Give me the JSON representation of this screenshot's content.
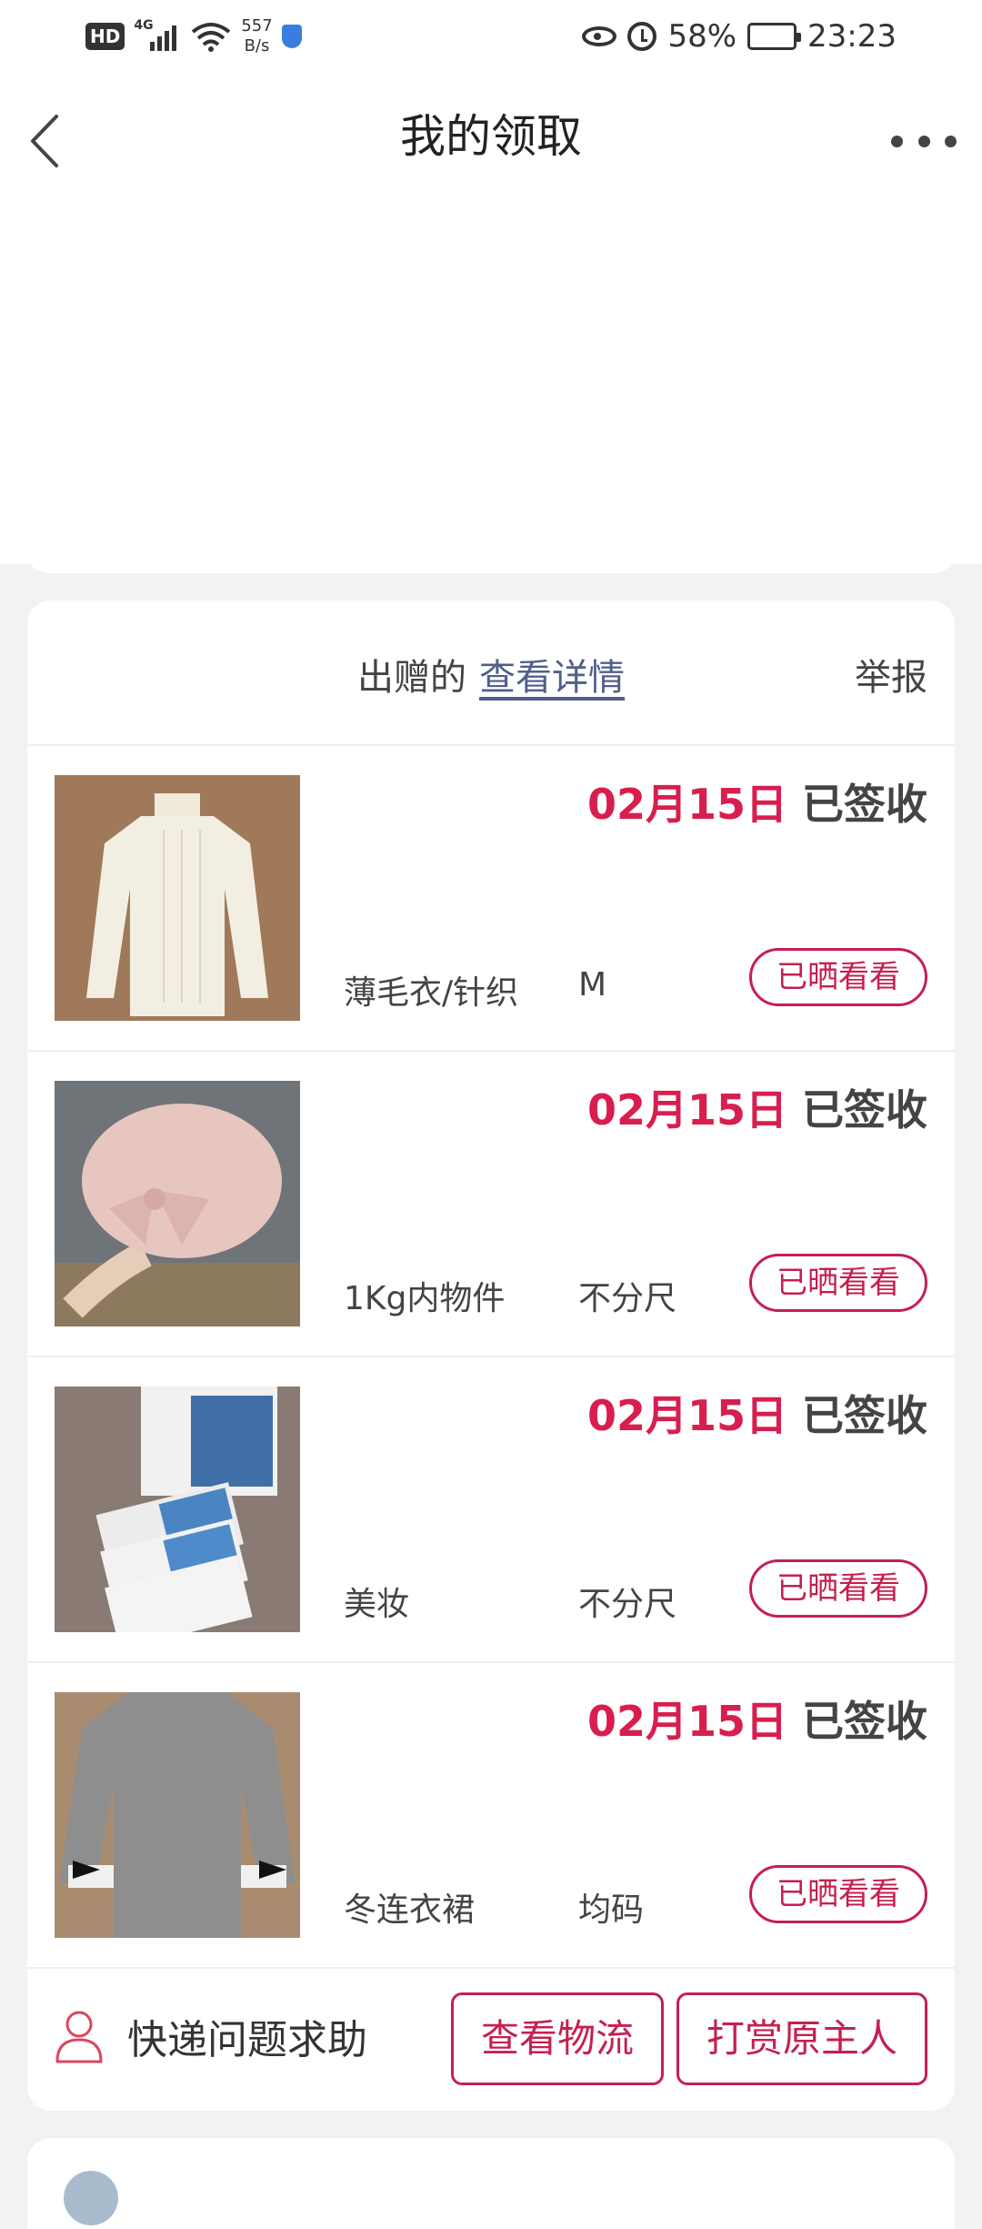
{
  "status_bar": {
    "hd_label": "HD",
    "network_label": "4G",
    "speed_value": "557",
    "speed_unit": "B/s",
    "battery_text": "58%",
    "time": "23:23"
  },
  "nav": {
    "title": "我的领取"
  },
  "card": {
    "header_prefix": "出赠的",
    "detail_link": "查看详情",
    "report_label": "举报",
    "items": [
      {
        "date": "02月15日",
        "status": "已签收",
        "category": "薄毛衣/针织",
        "size": "M",
        "button": "已晒看看"
      },
      {
        "date": "02月15日",
        "status": "已签收",
        "category": "1Kg内物件",
        "size": "不分尺",
        "button": "已晒看看"
      },
      {
        "date": "02月15日",
        "status": "已签收",
        "category": "美妆",
        "size": "不分尺",
        "button": "已晒看看"
      },
      {
        "date": "02月15日",
        "status": "已签收",
        "category": "冬连衣裙",
        "size": "均码",
        "button": "已晒看看"
      }
    ],
    "footer": {
      "help_label": "快递问题求助",
      "logistics_button": "查看物流",
      "tip_button": "打赏原主人"
    }
  },
  "colors": {
    "accent": "#d81e4e",
    "button_border": "#c5204f",
    "link": "#4f5f8a"
  }
}
